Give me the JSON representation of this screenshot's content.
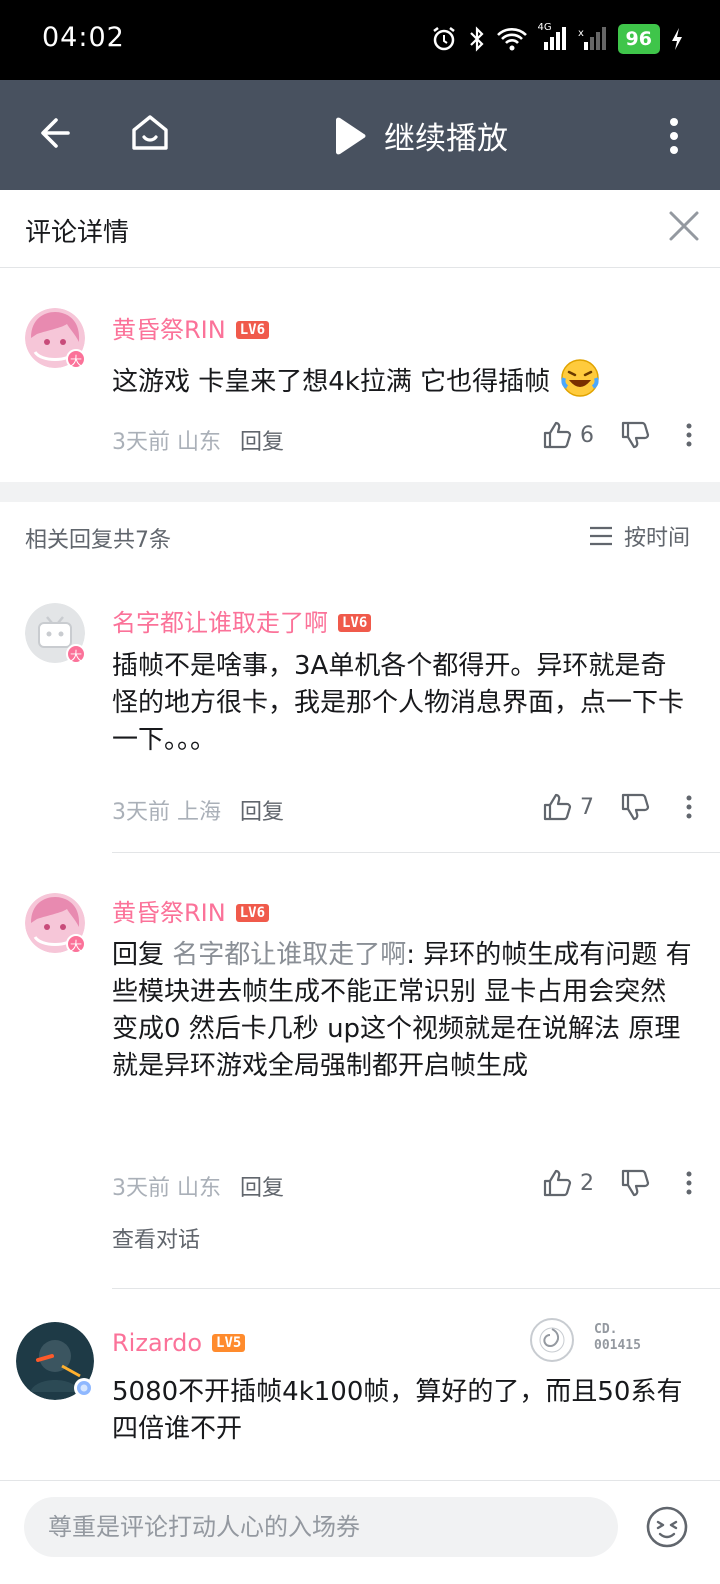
{
  "status_bar": {
    "time": "04:02",
    "network": "4G",
    "battery": "96"
  },
  "nav": {
    "play_label": "继续播放"
  },
  "header": {
    "title": "评论详情"
  },
  "main_comment": {
    "user": "黄昏祭RIN",
    "level": "LV6",
    "avatar_badge": "大",
    "text": "这游戏 卡皇来了想4k拉满 它也得插帧",
    "time": "3天前",
    "location": "山东",
    "reply_label": "回复",
    "likes": "6"
  },
  "related": {
    "label": "相关回复共7条",
    "sort_label": "按时间"
  },
  "replies": [
    {
      "user": "名字都让谁取走了啊",
      "level": "LV6",
      "avatar_badge": "大",
      "text": "插帧不是啥事，3A单机各个都得开。异环就是奇怪的地方很卡，我是那个人物消息界面，点一下卡一下。。。",
      "time": "3天前",
      "location": "上海",
      "reply_label": "回复",
      "likes": "7"
    },
    {
      "user": "黄昏祭RIN",
      "level": "LV6",
      "avatar_badge": "大",
      "reply_prefix": "回复 ",
      "reply_target": "名字都让谁取走了啊",
      "text": ": 异环的帧生成有问题 有些模块进去帧生成不能正常识别 显卡占用会突然变成0 然后卡几秒 up这个视频就是在说解法 原理就是异环游戏全局强制都开启帧生成",
      "time": "3天前",
      "location": "山东",
      "reply_label": "回复",
      "likes": "2",
      "view_conversation": "查看对话"
    },
    {
      "user": "Rizardo",
      "level": "LV5",
      "medal_code_1": "CD.",
      "medal_code_2": "001415",
      "text": "5080不开插帧4k100帧，算好的了，而且50系有四倍谁不开"
    }
  ],
  "input": {
    "placeholder": "尊重是评论打动人心的入场券"
  },
  "colors": {
    "accent": "#fb7299",
    "nav_bg": "#48515f",
    "battery": "#3fc54a"
  }
}
